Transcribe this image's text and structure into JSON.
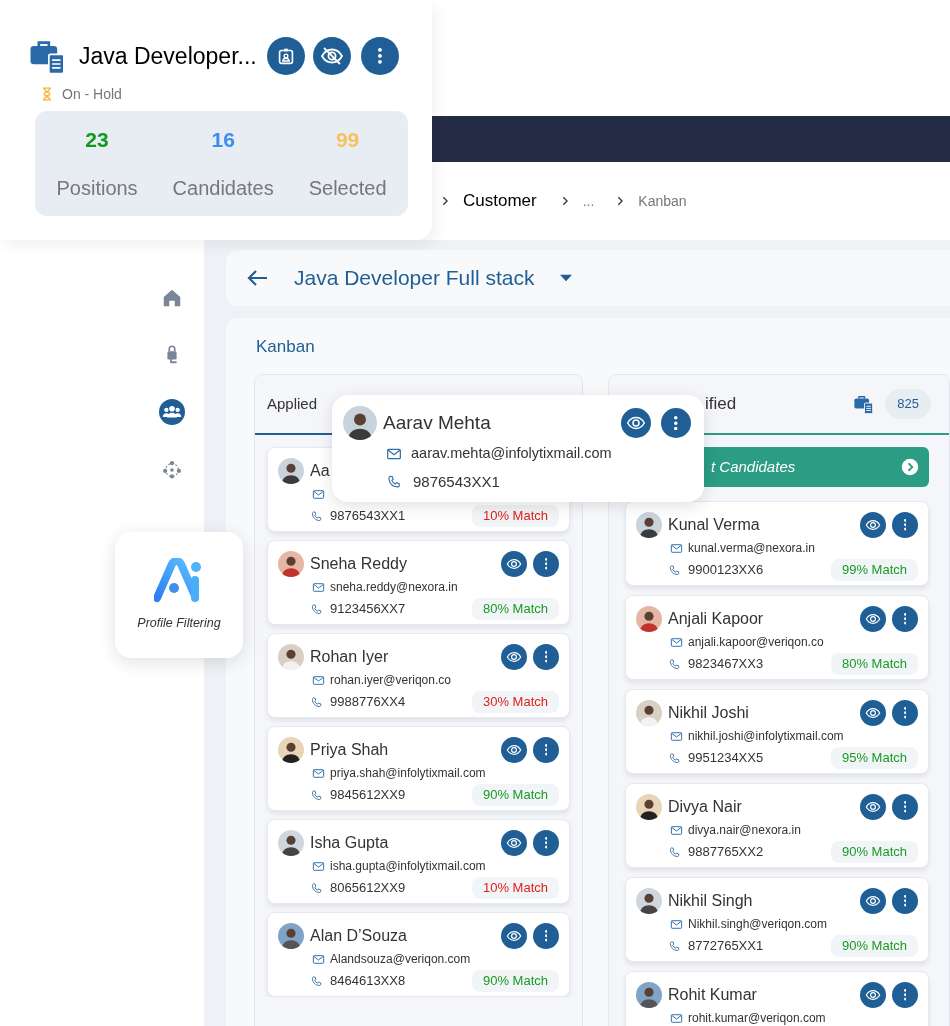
{
  "job": {
    "title": "Java Developer...",
    "status": "On - Hold",
    "stats": [
      {
        "value": "23",
        "label": "Positions",
        "color": "#129a1e"
      },
      {
        "value": "16",
        "label": "Candidates",
        "color": "#3d8df0"
      },
      {
        "value": "99",
        "label": "Selected",
        "color": "#f7c25d"
      }
    ]
  },
  "breadcrumb": [
    {
      "label": "Customer",
      "kind": "strong"
    },
    {
      "label": "...",
      "kind": "plain"
    },
    {
      "label": "Kanban",
      "kind": "plain"
    }
  ],
  "sidebar": {
    "items": [
      {
        "kind": "home",
        "selected": false
      },
      {
        "kind": "lock",
        "selected": false
      },
      {
        "kind": "team",
        "selected": true
      },
      {
        "kind": "network",
        "selected": false
      }
    ]
  },
  "page": {
    "title": "Java Developer Full stack"
  },
  "board": {
    "title": "Kanban",
    "columns": [
      {
        "title": "Applied",
        "color": "#1f5f96",
        "cards": [
          {
            "name": "Aa",
            "phone": "9876543XX1",
            "match": "10% Match",
            "color": "#e0201b"
          },
          {
            "name": "Sneha Reddy",
            "email": "sneha.reddy@nexora.in",
            "phone": "9123456XX7",
            "match": "80% Match",
            "color": "#1a9a22"
          },
          {
            "name": "Rohan Iyer",
            "email": "rohan.iyer@veriqon.co",
            "phone": "9988776XX4",
            "match": "30% Match",
            "color": "#e0201b"
          },
          {
            "name": "Priya Shah",
            "email": "priya.shah@infolytixmail.com",
            "phone": "9845612XX9",
            "match": "90% Match",
            "color": "#1a9a22"
          },
          {
            "name": "Isha Gupta",
            "email": "isha.gupta@infolytixmail.com",
            "phone": "8065612XX9",
            "match": "10% Match",
            "color": "#e0201b"
          },
          {
            "name": "Alan D’Souza",
            "email": "Alandsouza@veriqon.com",
            "phone": "8464613XX8",
            "match": "90% Match",
            "color": "#1a9a22"
          }
        ]
      },
      {
        "title": "ified",
        "color": "#2a9d84",
        "count": "825",
        "banner": "t Candidates",
        "cards": [
          {
            "name": "Kunal Verma",
            "email": "kunal.verma@nexora.in",
            "phone": "9900123XX6",
            "match": "99% Match",
            "color": "#1a9a22"
          },
          {
            "name": "Anjali Kapoor",
            "email": "anjali.kapoor@veriqon.co",
            "phone": "9823467XX3",
            "match": "80% Match",
            "color": "#1a9a22"
          },
          {
            "name": "Nikhil Joshi",
            "email": "nikhil.joshi@infolytixmail.com",
            "phone": "9951234XX5",
            "match": "95% Match",
            "color": "#1a9a22"
          },
          {
            "name": "Divya Nair",
            "email": "divya.nair@nexora.in",
            "phone": "9887765XX2",
            "match": "90% Match",
            "color": "#1a9a22"
          },
          {
            "name": "Nikhil Singh",
            "email": "Nikhil.singh@veriqon.com",
            "phone": "8772765XX1",
            "match": "90% Match",
            "color": "#1a9a22"
          },
          {
            "name": "Rohit Kumar",
            "email": "rohit.kumar@veriqon.com"
          }
        ]
      }
    ]
  },
  "popup": {
    "name": "Aarav Mehta",
    "email": "aarav.mehta@infolytixmail.com",
    "phone": "9876543XX1"
  },
  "ai_card": {
    "label": "Profile Filtering"
  }
}
